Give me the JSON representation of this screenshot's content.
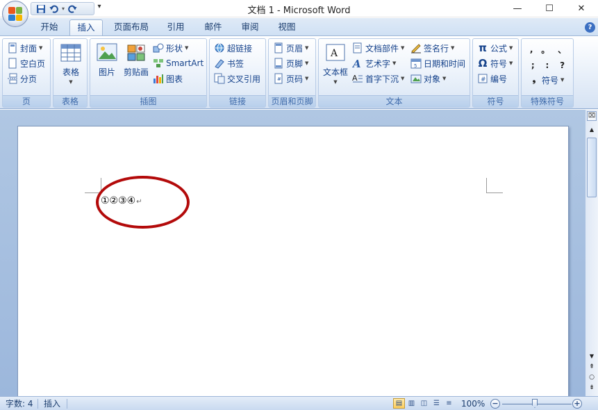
{
  "window": {
    "title": "文档 1 - Microsoft Word",
    "controls": {
      "minimize": "—",
      "maximize": "☐",
      "close": "✕"
    }
  },
  "quick_access": {
    "save_icon": "save-icon",
    "undo_icon": "undo-icon",
    "redo_icon": "redo-icon",
    "more_glyph": "▾"
  },
  "tabs": [
    {
      "label": "开始",
      "active": false
    },
    {
      "label": "插入",
      "active": true
    },
    {
      "label": "页面布局",
      "active": false
    },
    {
      "label": "引用",
      "active": false
    },
    {
      "label": "邮件",
      "active": false
    },
    {
      "label": "审阅",
      "active": false
    },
    {
      "label": "视图",
      "active": false
    }
  ],
  "help_glyph": "?",
  "ribbon": {
    "pages": {
      "label": "页",
      "items": [
        "封面",
        "空白页",
        "分页"
      ]
    },
    "tables": {
      "label": "表格",
      "button": "表格"
    },
    "illustrations": {
      "label": "插图",
      "picture": "图片",
      "clipart": "剪贴画",
      "shapes": "形状",
      "smartart": "SmartArt",
      "chart": "图表"
    },
    "links": {
      "label": "链接",
      "items": [
        "超链接",
        "书签",
        "交叉引用"
      ]
    },
    "header_footer": {
      "label": "页眉和页脚",
      "items": [
        "页眉",
        "页脚",
        "页码"
      ]
    },
    "text": {
      "label": "文本",
      "textbox": "文本框",
      "col1": [
        "文档部件",
        "艺术字",
        "首字下沉"
      ],
      "col2": [
        "签名行",
        "日期和时间",
        "对象"
      ]
    },
    "symbols": {
      "label": "符号",
      "items": [
        "公式",
        "符号",
        "编号"
      ],
      "formula_glyph": "π",
      "symbol_glyph": "Ω"
    },
    "special": {
      "label": "特殊符号",
      "row1": [
        ",",
        "。",
        "、"
      ],
      "row2": [
        ";",
        ":",
        "?"
      ],
      "more_label": "符号",
      "more_glyph": "❟"
    }
  },
  "document": {
    "text": "①②③④",
    "para_mark": "↵"
  },
  "colors": {
    "highlight_circle": "#b30a0a",
    "accent": "#15428b"
  },
  "statusbar": {
    "word_count": "字数: 4",
    "mode": "插入",
    "zoom": "100%",
    "zoom_out": "−",
    "zoom_in": "+"
  }
}
